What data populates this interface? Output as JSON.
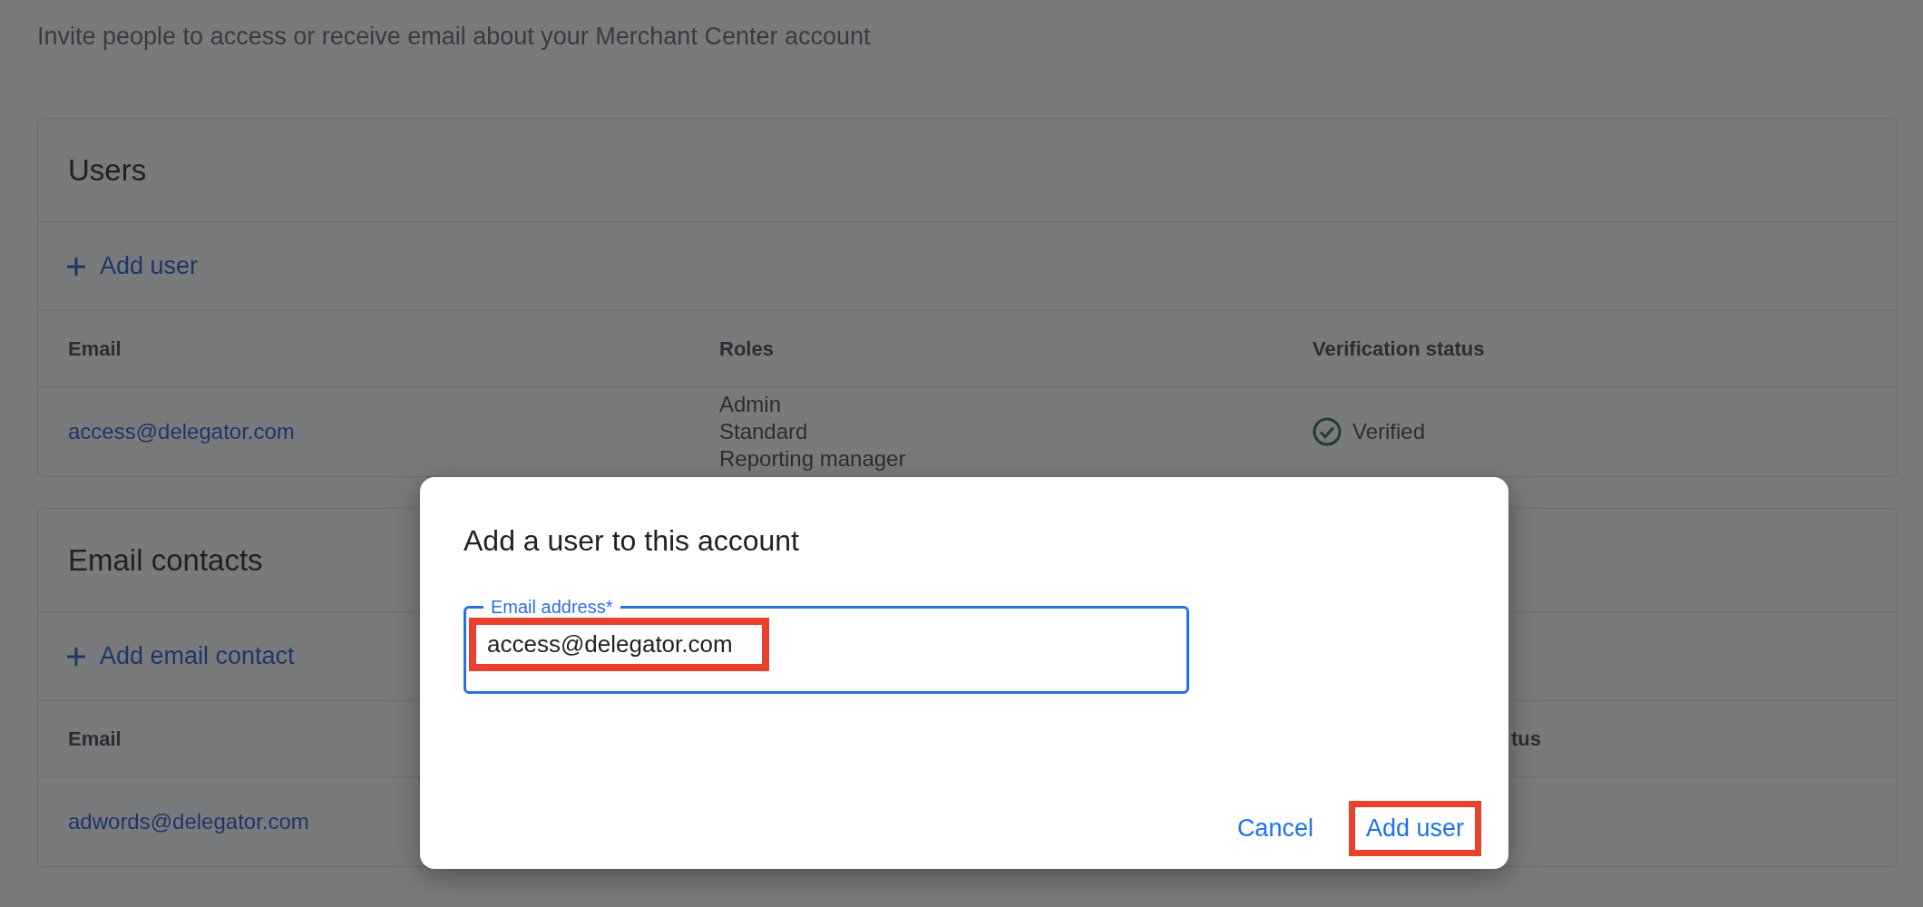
{
  "subtitle": "Invite people to access or receive email about your Merchant Center account",
  "sections": [
    {
      "kind": "users",
      "title": "Users",
      "add_action": "Add user",
      "columns": [
        "Email",
        "Roles",
        "Verification status"
      ],
      "rows": [
        {
          "email": "access@delegator.com",
          "roles": [
            "Admin",
            "Standard",
            "Reporting manager"
          ],
          "status": "Verified",
          "verified": true
        }
      ]
    },
    {
      "kind": "contacts",
      "title": "Email contacts",
      "add_action": "Add email contact",
      "columns": [
        "Email",
        "tus"
      ],
      "rows": [
        {
          "email": "adwords@delegator.com"
        }
      ]
    }
  ],
  "dialog": {
    "title": "Add a user to this account",
    "field": {
      "label": "Email address*",
      "value": "access@delegator.com",
      "focused": true,
      "highlighted": true
    },
    "actions": [
      {
        "label": "Cancel",
        "highlighted": false
      },
      {
        "label": "Add user",
        "highlighted": true
      }
    ]
  }
}
